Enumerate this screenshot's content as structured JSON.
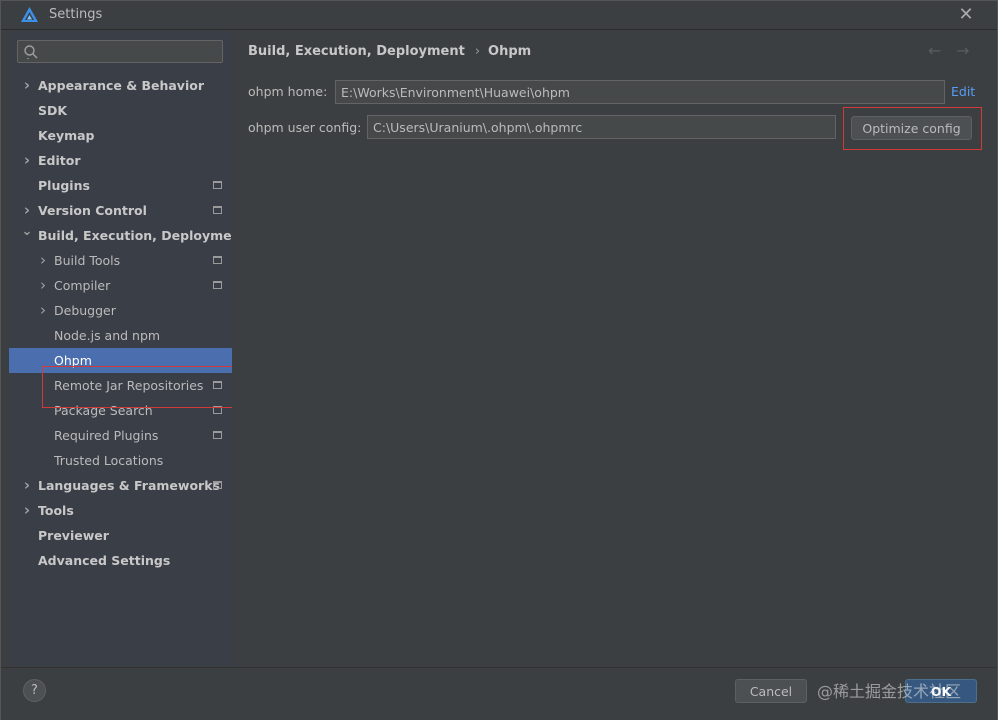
{
  "window": {
    "title": "Settings"
  },
  "search": {
    "placeholder": ""
  },
  "sidebar": {
    "items": [
      {
        "label": "Appearance & Behavior",
        "level": 0,
        "bold": true,
        "expandable": true,
        "expanded": false,
        "project_icon": false
      },
      {
        "label": "SDK",
        "level": 0,
        "bold": true,
        "expandable": false,
        "project_icon": false
      },
      {
        "label": "Keymap",
        "level": 0,
        "bold": true,
        "expandable": false,
        "project_icon": false
      },
      {
        "label": "Editor",
        "level": 0,
        "bold": true,
        "expandable": true,
        "expanded": false,
        "project_icon": false
      },
      {
        "label": "Plugins",
        "level": 0,
        "bold": true,
        "expandable": false,
        "project_icon": true
      },
      {
        "label": "Version Control",
        "level": 0,
        "bold": true,
        "expandable": true,
        "expanded": false,
        "project_icon": true
      },
      {
        "label": "Build, Execution, Deployment",
        "level": 0,
        "bold": true,
        "expandable": true,
        "expanded": true,
        "project_icon": false
      },
      {
        "label": "Build Tools",
        "level": 1,
        "bold": false,
        "expandable": true,
        "expanded": false,
        "project_icon": true
      },
      {
        "label": "Compiler",
        "level": 1,
        "bold": false,
        "expandable": true,
        "expanded": false,
        "project_icon": true
      },
      {
        "label": "Debugger",
        "level": 1,
        "bold": false,
        "expandable": true,
        "expanded": false,
        "project_icon": false
      },
      {
        "label": "Node.js and npm",
        "level": 1,
        "bold": false,
        "expandable": false,
        "project_icon": false
      },
      {
        "label": "Ohpm",
        "level": 1,
        "bold": false,
        "expandable": false,
        "project_icon": false,
        "selected": true
      },
      {
        "label": "Remote Jar Repositories",
        "level": 1,
        "bold": false,
        "expandable": false,
        "project_icon": true
      },
      {
        "label": "Package Search",
        "level": 1,
        "bold": false,
        "expandable": false,
        "project_icon": true
      },
      {
        "label": "Required Plugins",
        "level": 1,
        "bold": false,
        "expandable": false,
        "project_icon": true
      },
      {
        "label": "Trusted Locations",
        "level": 1,
        "bold": false,
        "expandable": false,
        "project_icon": false
      },
      {
        "label": "Languages & Frameworks",
        "level": 0,
        "bold": true,
        "expandable": true,
        "expanded": false,
        "project_icon": true
      },
      {
        "label": "Tools",
        "level": 0,
        "bold": true,
        "expandable": true,
        "expanded": false,
        "project_icon": false
      },
      {
        "label": "Previewer",
        "level": 0,
        "bold": true,
        "expandable": false,
        "project_icon": false
      },
      {
        "label": "Advanced Settings",
        "level": 0,
        "bold": true,
        "expandable": false,
        "project_icon": false
      }
    ]
  },
  "content": {
    "breadcrumb": {
      "parent": "Build, Execution, Deployment",
      "separator": "›",
      "current": "Ohpm"
    },
    "nav": {
      "back_icon": "←",
      "forward_icon": "→"
    },
    "ohpm_home": {
      "label": "ohpm home:",
      "value": "E:\\Works\\Environment\\Huawei\\ohpm",
      "edit_label": "Edit"
    },
    "ohpm_user_config": {
      "label": "ohpm user config:",
      "value": "C:\\Users\\Uranium\\.ohpm\\.ohpmrc",
      "button_label": "Optimize config"
    }
  },
  "footer": {
    "help_label": "?",
    "cancel_label": "Cancel",
    "ok_label": "OK",
    "watermark": "@稀土掘金技术社区"
  },
  "colors": {
    "selection": "#4b6eaf",
    "link": "#589df6",
    "highlight_box": "#d23a3a",
    "primary_button": "#365880"
  },
  "icons": {
    "logo": "deveco-logo-icon",
    "close": "close-icon",
    "search": "search-icon",
    "expand": "chevron-right-icon",
    "expanded": "chevron-down-icon",
    "project_scope": "project-scope-icon"
  }
}
